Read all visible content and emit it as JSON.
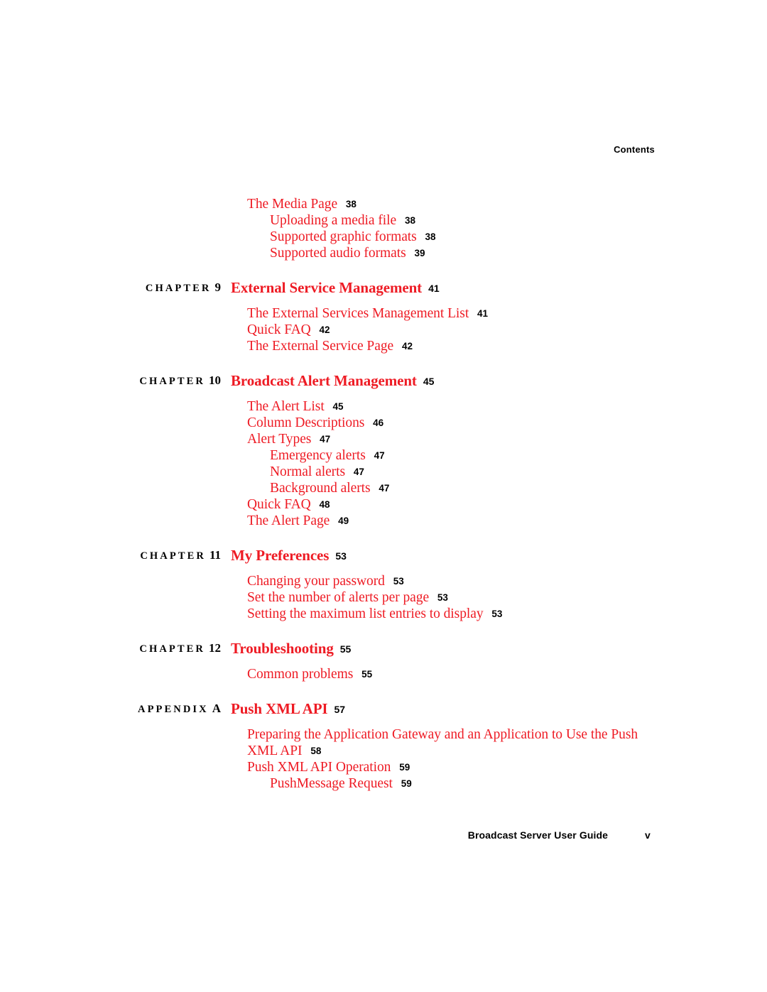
{
  "page": {
    "running_head": "Contents",
    "footer_title": "Broadcast Server User Guide",
    "footer_page": "v",
    "accent_color": "#ee1b24",
    "text_color": "#000000",
    "background_color": "#ffffff"
  },
  "toc": {
    "blocks": [
      {
        "kind": "continuation",
        "heading": null,
        "entries": [
          {
            "level": 1,
            "title": "The Media Page",
            "page": "38"
          },
          {
            "level": 2,
            "title": "Uploading a media file",
            "page": "38"
          },
          {
            "level": 2,
            "title": "Supported graphic formats",
            "page": "38"
          },
          {
            "level": 2,
            "title": "Supported audio formats",
            "page": "39"
          }
        ]
      },
      {
        "kind": "chapter",
        "heading": {
          "label": "C H A P T E R",
          "label_word": "CHAPTER",
          "number": "9",
          "title": "External Service Management",
          "page": "41"
        },
        "entries": [
          {
            "level": 1,
            "title": "The External Services Management List",
            "page": "41"
          },
          {
            "level": 1,
            "title": "Quick FAQ",
            "page": "42"
          },
          {
            "level": 1,
            "title": "The External Service Page",
            "page": "42"
          }
        ]
      },
      {
        "kind": "chapter",
        "heading": {
          "label": "C H A P T E R",
          "label_word": "CHAPTER",
          "number": "10",
          "title": "Broadcast Alert Management",
          "page": "45"
        },
        "entries": [
          {
            "level": 1,
            "title": "The Alert List",
            "page": "45"
          },
          {
            "level": 1,
            "title": "Column Descriptions",
            "page": "46"
          },
          {
            "level": 1,
            "title": "Alert Types",
            "page": "47"
          },
          {
            "level": 2,
            "title": "Emergency alerts",
            "page": "47"
          },
          {
            "level": 2,
            "title": "Normal alerts",
            "page": "47"
          },
          {
            "level": 2,
            "title": "Background alerts",
            "page": "47"
          },
          {
            "level": 1,
            "title": "Quick FAQ",
            "page": "48"
          },
          {
            "level": 1,
            "title": "The Alert Page",
            "page": "49"
          }
        ]
      },
      {
        "kind": "chapter",
        "heading": {
          "label": "C H A P T E R",
          "label_word": "CHAPTER",
          "number": "11",
          "title": "My Preferences",
          "page": "53"
        },
        "entries": [
          {
            "level": 1,
            "title": "Changing your password",
            "page": "53"
          },
          {
            "level": 1,
            "title": "Set the number of alerts per page",
            "page": "53"
          },
          {
            "level": 1,
            "title": "Setting the maximum list entries to display",
            "page": "53"
          }
        ]
      },
      {
        "kind": "chapter",
        "heading": {
          "label": "C H A P T E R",
          "label_word": "CHAPTER",
          "number": "12",
          "title": "Troubleshooting",
          "page": "55"
        },
        "entries": [
          {
            "level": 1,
            "title": "Common problems",
            "page": "55"
          }
        ]
      },
      {
        "kind": "appendix",
        "heading": {
          "label": "A P P E N D I X",
          "label_word": "APPENDIX",
          "number": "A",
          "title": "Push XML API",
          "page": "57"
        },
        "entries": [
          {
            "level": 1,
            "title": "Preparing the Application Gateway and an Application to Use the Push XML API",
            "page": "58"
          },
          {
            "level": 1,
            "title": "Push XML API Operation",
            "page": "59"
          },
          {
            "level": 2,
            "title": "PushMessage Request",
            "page": "59"
          }
        ]
      }
    ]
  }
}
